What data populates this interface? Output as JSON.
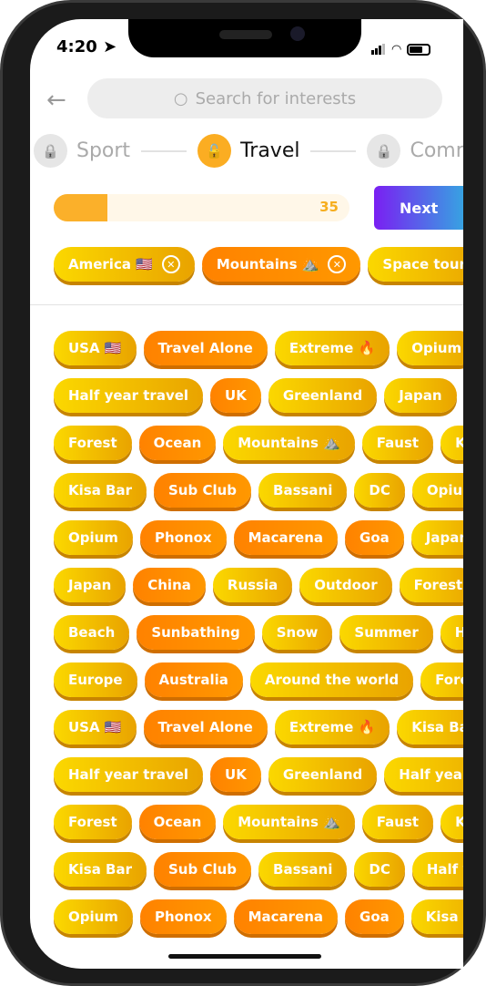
{
  "status": {
    "time": "4:20"
  },
  "search": {
    "placeholder": "Search for interests"
  },
  "steps": [
    {
      "label": "Sport",
      "state": "locked"
    },
    {
      "label": "Travel",
      "state": "active"
    },
    {
      "label": "Comm",
      "state": "locked"
    }
  ],
  "progress": {
    "value": 35,
    "label": "35",
    "fill_fraction": 0.18
  },
  "next_label": "Next",
  "selected": [
    {
      "label": "America 🇺🇸",
      "color": "y"
    },
    {
      "label": "Mountains ⛰️",
      "color": "o"
    },
    {
      "label": "Space touri",
      "color": "y"
    }
  ],
  "rows": [
    [
      [
        "USA 🇺🇸",
        "y"
      ],
      [
        "Travel Alone",
        "o"
      ],
      [
        "Extreme 🔥",
        "y"
      ],
      [
        "Opium",
        "y"
      ]
    ],
    [
      [
        "Half year travel",
        "y"
      ],
      [
        "UK",
        "o"
      ],
      [
        "Greenland",
        "y"
      ],
      [
        "Japan",
        "y"
      ],
      [
        "",
        "o"
      ]
    ],
    [
      [
        "Forest",
        "y"
      ],
      [
        "Ocean",
        "o"
      ],
      [
        "Mountains ⛰️",
        "y"
      ],
      [
        "Faust",
        "y"
      ],
      [
        "Kisa",
        "y"
      ]
    ],
    [
      [
        "Kisa Bar",
        "y"
      ],
      [
        "Sub Club",
        "o"
      ],
      [
        "Bassani",
        "y"
      ],
      [
        "DC",
        "y"
      ],
      [
        "Opium",
        "y"
      ]
    ],
    [
      [
        "Opium",
        "y"
      ],
      [
        "Phonox",
        "o"
      ],
      [
        "Macarena",
        "o"
      ],
      [
        "Goa",
        "o"
      ],
      [
        "Japan",
        "y"
      ]
    ],
    [
      [
        "Japan",
        "y"
      ],
      [
        "China",
        "o"
      ],
      [
        "Russia",
        "y"
      ],
      [
        "Outdoor",
        "y"
      ],
      [
        "Forest",
        "y"
      ]
    ],
    [
      [
        "Beach",
        "y"
      ],
      [
        "Sunbathing",
        "o"
      ],
      [
        "Snow",
        "y"
      ],
      [
        "Summer",
        "y"
      ],
      [
        "Ha",
        "y"
      ]
    ],
    [
      [
        "Europe",
        "y"
      ],
      [
        "Australia",
        "o"
      ],
      [
        "Around the world",
        "y"
      ],
      [
        "Forest",
        "y"
      ]
    ],
    [
      [
        "USA 🇺🇸",
        "y"
      ],
      [
        "Travel Alone",
        "o"
      ],
      [
        "Extreme 🔥",
        "y"
      ],
      [
        "Kisa Bar",
        "y"
      ]
    ],
    [
      [
        "Half year travel",
        "y"
      ],
      [
        "UK",
        "o"
      ],
      [
        "Greenland",
        "y"
      ],
      [
        "Half year tra",
        "y"
      ]
    ],
    [
      [
        "Forest",
        "y"
      ],
      [
        "Ocean",
        "o"
      ],
      [
        "Mountains ⛰️",
        "y"
      ],
      [
        "Faust",
        "y"
      ],
      [
        "Kisa",
        "y"
      ]
    ],
    [
      [
        "Kisa Bar",
        "y"
      ],
      [
        "Sub Club",
        "o"
      ],
      [
        "Bassani",
        "y"
      ],
      [
        "DC",
        "y"
      ],
      [
        "Half ye",
        "y"
      ]
    ],
    [
      [
        "Opium",
        "y"
      ],
      [
        "Phonox",
        "o"
      ],
      [
        "Macarena",
        "o"
      ],
      [
        "Goa",
        "o"
      ],
      [
        "Kisa Ba",
        "y"
      ]
    ]
  ],
  "colors": {
    "yellow": "#fbd800",
    "orange": "#ff8a00",
    "accent": "#fbad22",
    "next_gradient": [
      "#7a1ff2",
      "#2fb2e0"
    ]
  }
}
